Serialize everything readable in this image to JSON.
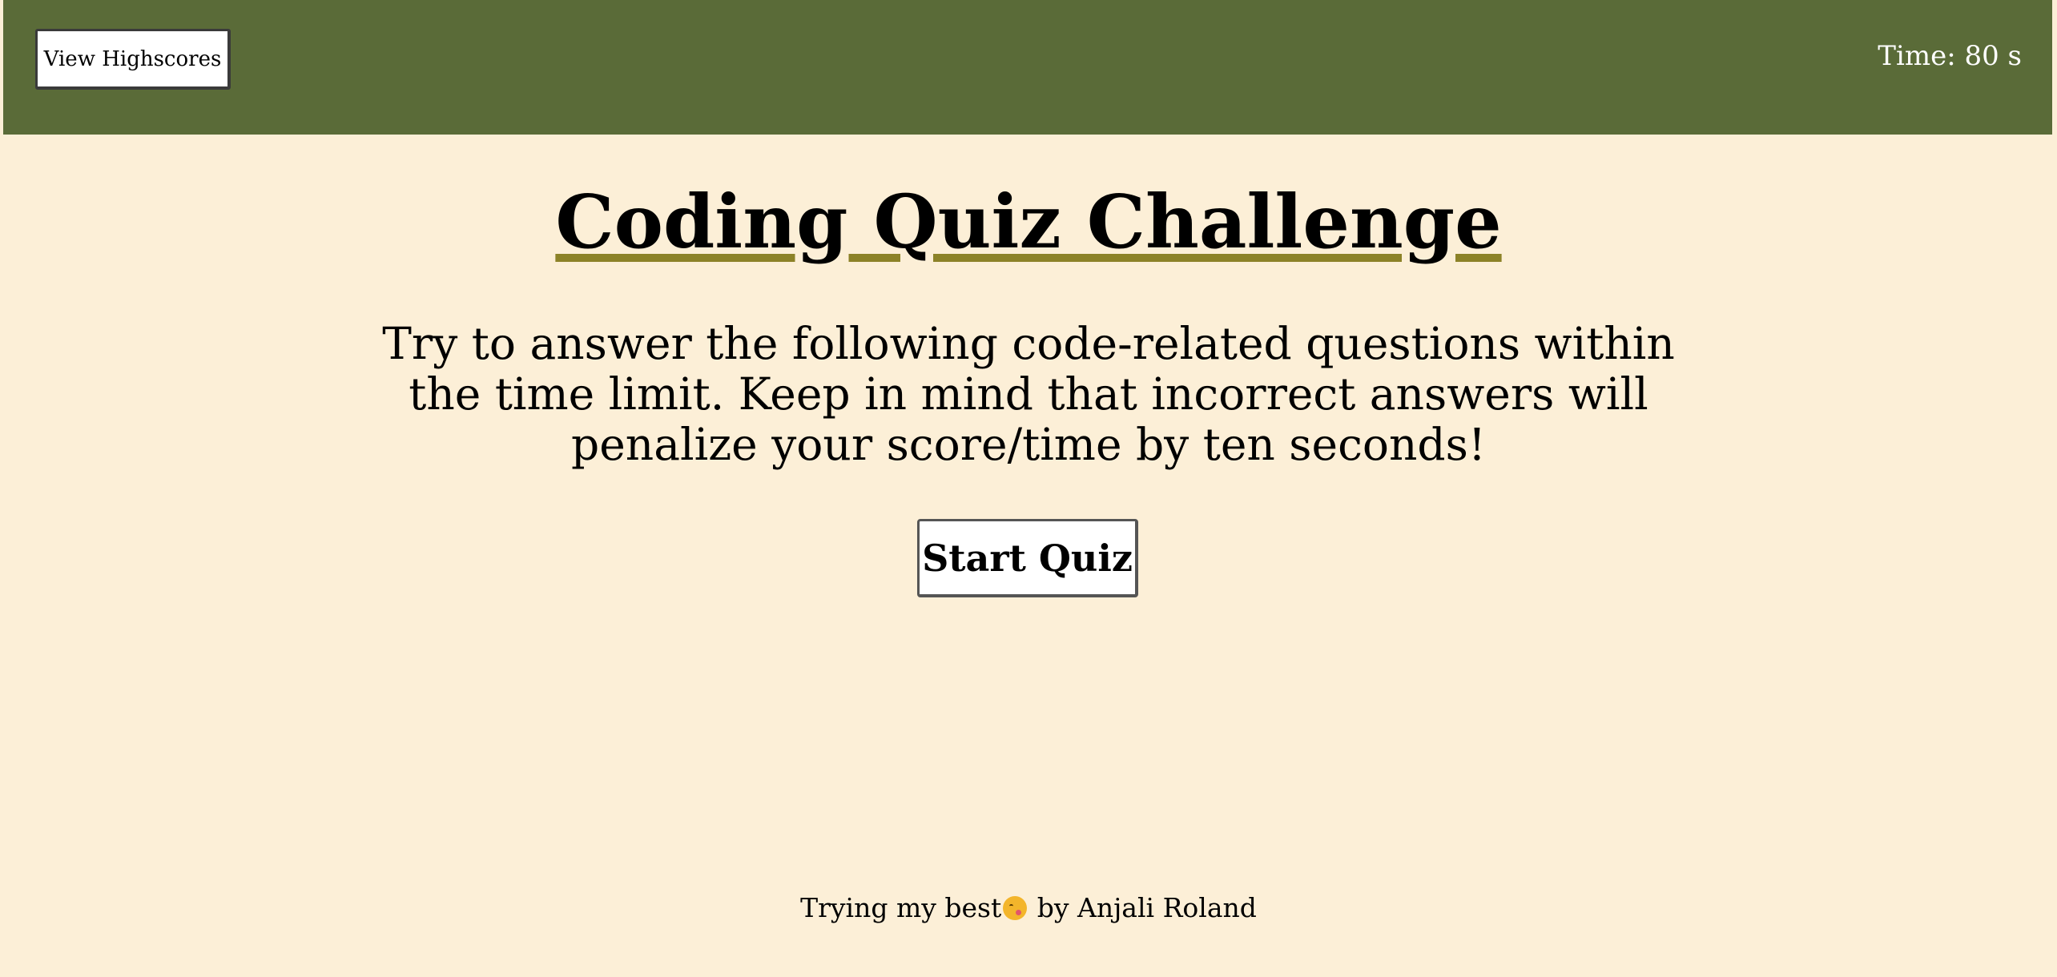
{
  "header": {
    "highscores_label": "View Highscores",
    "timer_prefix": "Time:",
    "timer_value": "80",
    "timer_unit": "s"
  },
  "main": {
    "title": "Coding Quiz Challenge",
    "intro": "Try to answer the following code-related questions within the time limit. Keep in mind that incorrect answers will penalize your score/time by ten seconds!",
    "start_label": "Start Quiz"
  },
  "footer": {
    "text_before": "Trying my best",
    "emoji_icon": "winking-face-tongue-icon",
    "text_after": " by Anjali Roland"
  },
  "colors": {
    "header_bg": "#5a6b38",
    "page_bg": "#fcefd7",
    "title_underline": "#8c8227",
    "timer_text": "#ffffff"
  }
}
